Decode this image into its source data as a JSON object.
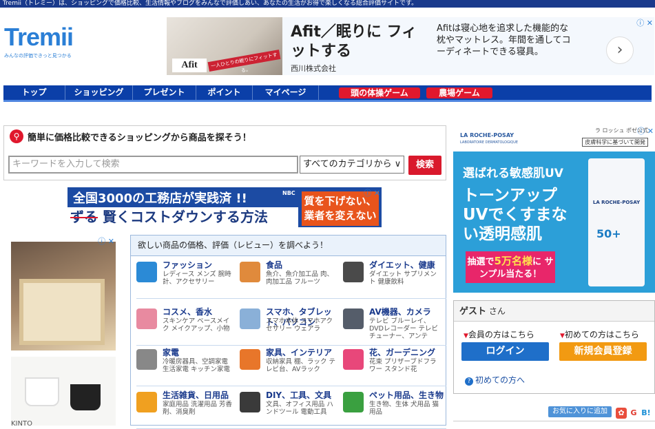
{
  "topbar": {
    "text": "Tremii（トレミー）は、ショッピングで価格比較、生活情報やブログをみんなで評価しあい、あなたの生活がお得で楽しくなる総合評価サイトです。"
  },
  "logo": {
    "word": "Tremii",
    "tagline": "みんなの評価できっと見つかる"
  },
  "top_ad": {
    "headline": "Afit／眠りに フィットする",
    "company": "西川株式会社",
    "description": "Afitは寝心地を追求した機能的な枕やマットレス。年間を通してコーディネートできる寝具。",
    "image_stamp": "Afit",
    "image_band": "一人ひとりの眠りにフィットする。",
    "arrow": "›",
    "ad_choice": "ⓘ ✕"
  },
  "nav": {
    "items": [
      "トップ",
      "ショッピング",
      "プレゼント",
      "ポイント",
      "マイページ"
    ],
    "red_items": [
      "頭の体操ゲーム",
      "農場ゲーム"
    ]
  },
  "search": {
    "title": "簡単に価格比較できるショッピングから商品を探そう！",
    "placeholder": "キーワードを入力して検索",
    "category": "すべてのカテゴリから ∨",
    "button": "検索"
  },
  "mid_ad": {
    "line1": "全国3000の工務店が実践済 !!",
    "line2_strike": "ずる",
    "line2": " 賢くコストダウンする方法",
    "side": "質を下げない、業者を変えない",
    "nbc": "NBC",
    "ad_choice": "ⓘ ✕"
  },
  "left_ad": {
    "brand": "KINTO",
    "ad_choice": "ⓘ ✕"
  },
  "categories": {
    "header": "欲しい商品の価格、評価（レビュー）を調べよう！",
    "items": [
      {
        "title": "ファッション",
        "sub": "レディース メンズ 腕時計、アクセサリー",
        "color": "#2b8ad6"
      },
      {
        "title": "食品",
        "sub": "魚介、魚介加工品 肉、肉加工品 フルーツ",
        "color": "#e08a3c"
      },
      {
        "title": "ダイエット、健康",
        "sub": "ダイエット サプリメント 健康飲料",
        "color": "#4a4a4a"
      },
      {
        "title": "コスメ、香水",
        "sub": "スキンケア ベースメイク メイクアップ、小物",
        "color": "#e88aa0"
      },
      {
        "title": "スマホ、タブレット、パソコン",
        "sub": "スマホ本体 スマホアクセサリー ウェアラ",
        "color": "#8ab0d8"
      },
      {
        "title": "AV機器、カメラ",
        "sub": "テレビ ブルーレイ、DVDレコーダー テレビチューナー、アンテ",
        "color": "#555d6a"
      },
      {
        "title": "家電",
        "sub": "冷暖房器具、空調家電 生活家電 キッチン家電",
        "color": "#888"
      },
      {
        "title": "家具、インテリア",
        "sub": "収納家具 棚、ラック テレビ台、AVラック",
        "color": "#e8762a"
      },
      {
        "title": "花、ガーデニング",
        "sub": "花束 プリザーブドフラワー スタンド花",
        "color": "#e8477a"
      },
      {
        "title": "生活雑貨、日用品",
        "sub": "家庭用品 洗濯用品 芳香剤、消臭剤",
        "color": "#f0a020"
      },
      {
        "title": "DIY、工具、文具",
        "sub": "文具、オフィス用品 ハンドツール 電動工具",
        "color": "#3a3a3a"
      },
      {
        "title": "ペット用品、生き物",
        "sub": "生き物、生体 犬用品 猫用品",
        "color": "#3aa040"
      }
    ]
  },
  "right_ad": {
    "brand": "LA ROCHE-POSAY",
    "brand_sub": "LABORATOIRE DERMATOLOGIQUE",
    "jp_brand": "ラ ロッシュ ポゼ公式",
    "jp_tag": "皮膚科学に基づいて開発",
    "line1": "選ばれる敏感肌UV",
    "line2": "トーンアップUVでくすまない透明感肌",
    "promo_pre": "抽選で",
    "promo_num": "5万名様",
    "promo_post": "に サンプル当たる！",
    "tube_label": "LA ROCHE-POSAY",
    "tube_num": "50+",
    "ad_choice": "ⓘ ✕"
  },
  "guest": {
    "name": "ゲスト",
    "suffix": "さん",
    "member_label": "会員の方はこちら",
    "first_label": "初めての方はこちら",
    "login": "ログイン",
    "register": "新規会員登録",
    "first_time": "初めての方へ"
  },
  "footer": {
    "favorite": "お気に入りに追加",
    "g": "G",
    "bi": "B!"
  }
}
